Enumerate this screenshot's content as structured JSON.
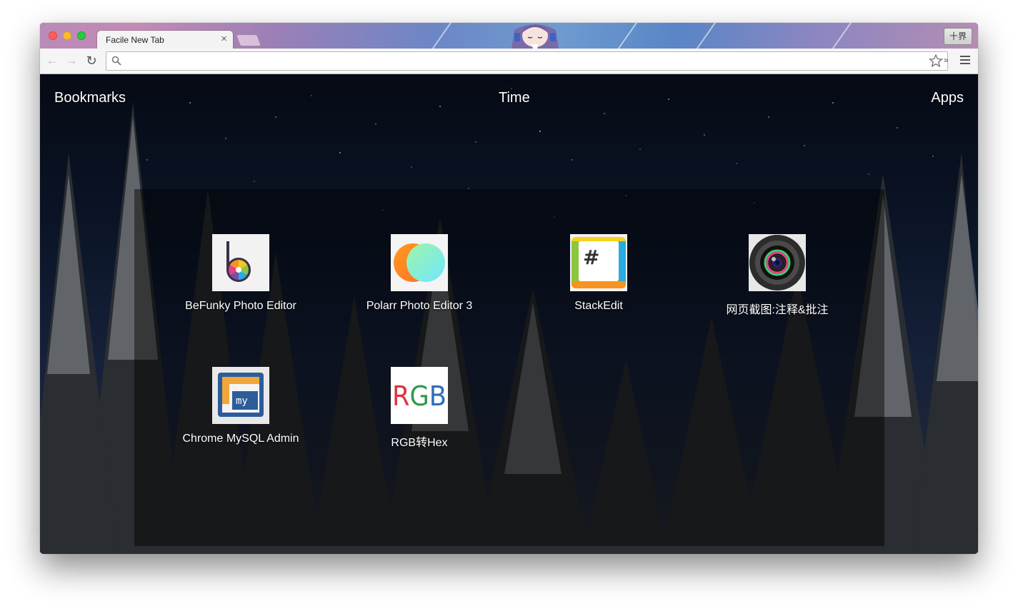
{
  "browser": {
    "tab_title": "Facile New Tab",
    "tab_close": "×",
    "profile_label": "十界",
    "address_value": "",
    "extensions_chevron": "»"
  },
  "page": {
    "bookmarks_label": "Bookmarks",
    "time_label": "Time",
    "apps_label": "Apps"
  },
  "apps": [
    {
      "name": "BeFunky Photo Editor",
      "icon": "befunky-icon"
    },
    {
      "name": "Polarr Photo Editor 3",
      "icon": "polarr-icon"
    },
    {
      "name": "StackEdit",
      "icon": "stackedit-icon"
    },
    {
      "name": "网页截图:注释&批注",
      "icon": "camera-lens-icon"
    },
    {
      "name": "Chrome MySQL Admin",
      "icon": "mysql-admin-icon"
    },
    {
      "name": "RGB转Hex",
      "icon": "rgb-icon",
      "icon_text": "RGB"
    }
  ],
  "colors": {
    "page_text": "#ffffff",
    "panel_overlay": "rgba(0,0,0,0.45)",
    "tab_bg": "#f3f3f3"
  }
}
